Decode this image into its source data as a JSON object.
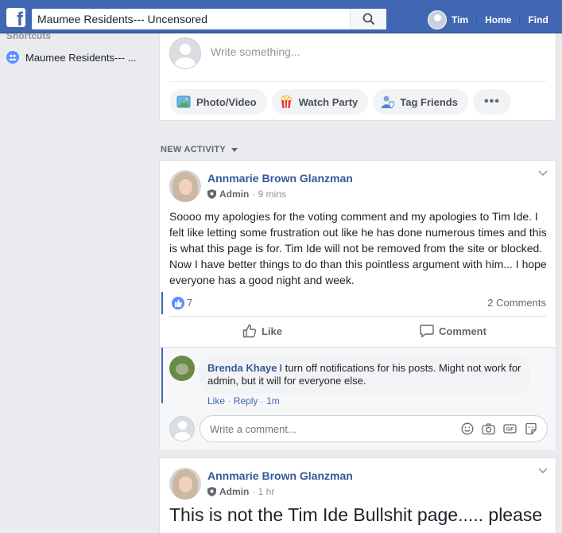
{
  "topbar": {
    "search_value": "Maumee Residents--- Uncensored",
    "user_name": "Tim",
    "nav_home": "Home",
    "nav_find": "Find"
  },
  "sidebar": {
    "section_title": "Shortcuts",
    "items": [
      {
        "label": "Maumee Residents--- ..."
      }
    ]
  },
  "composer": {
    "placeholder": "Write something...",
    "actions": [
      {
        "label": "Photo/Video",
        "icon": "photo-icon"
      },
      {
        "label": "Watch Party",
        "icon": "popcorn-icon"
      },
      {
        "label": "Tag Friends",
        "icon": "tag-friends-icon"
      },
      {
        "label": "•••",
        "icon": "more-icon"
      }
    ]
  },
  "feed": {
    "section_label": "NEW ACTIVITY"
  },
  "posts": [
    {
      "author": "Annmarie Brown Glanzman",
      "role": "Admin",
      "time": "· 9 mins",
      "text": "Soooo my apologies for the voting comment and my apologies to Tim Ide. I felt like letting some frustration out like he has done numerous times and this is what this page is for. Tim Ide will not be removed from the site or blocked. Now I have better things to do than this pointless argument with him... I hope everyone has a good night and week.",
      "reaction_count": "7",
      "comments_count": "2 Comments",
      "like_label": "Like",
      "comment_label": "Comment",
      "comment": {
        "author": "Brenda Khaye",
        "text": "I turn off notifications for his posts. Might not work for admin, but it will for everyone else.",
        "like": "Like",
        "reply": "Reply",
        "sep": "·",
        "time": "1m"
      },
      "write_comment_placeholder": "Write a comment..."
    },
    {
      "author": "Annmarie Brown Glanzman",
      "role": "Admin",
      "time": "· 1 hr",
      "text": "This is not the Tim Ide Bullshit page..... please"
    }
  ],
  "colors": {
    "brand": "#4267b2",
    "link": "#365899",
    "background": "#e9ebee"
  }
}
